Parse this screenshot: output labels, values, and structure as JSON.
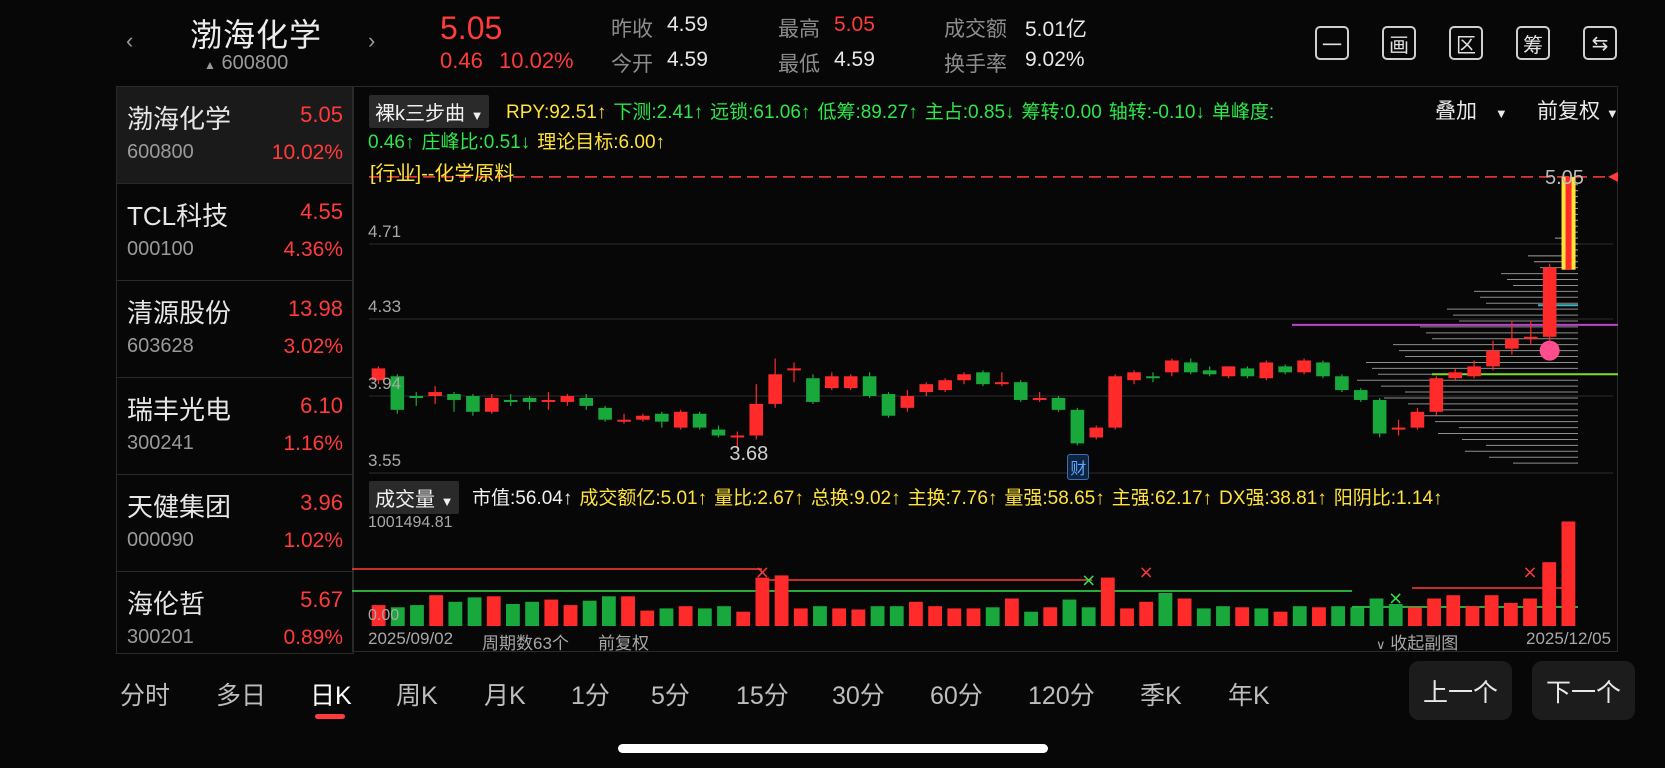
{
  "header": {
    "prev_icon": "chevron-left-icon",
    "next_icon": "chevron-right-icon",
    "stock_name": "渤海化学",
    "stock_code": "600800",
    "price": "5.05",
    "change": "0.46",
    "change_pct": "10.02%",
    "prev_close_label": "昨收",
    "prev_close": "4.59",
    "open_label": "今开",
    "open": "4.59",
    "high_label": "最高",
    "high": "5.05",
    "low_label": "最低",
    "low": "4.59",
    "amount_label": "成交额",
    "amount": "5.01亿",
    "turnover_label": "换手率",
    "turnover": "9.02%",
    "icons": [
      {
        "glyph": "一",
        "name": "minus-icon"
      },
      {
        "glyph": "画",
        "name": "draw-icon"
      },
      {
        "glyph": "区",
        "name": "range-icon"
      },
      {
        "glyph": "筹",
        "name": "chips-icon"
      },
      {
        "glyph": "⇆",
        "name": "switch-screen-icon"
      }
    ]
  },
  "watchlist": [
    {
      "name": "渤海化学",
      "code": "600800",
      "price": "5.05",
      "pct": "10.02%"
    },
    {
      "name": "TCL科技",
      "code": "000100",
      "price": "4.55",
      "pct": "4.36%"
    },
    {
      "name": "清源股份",
      "code": "603628",
      "price": "13.98",
      "pct": "3.02%"
    },
    {
      "name": "瑞丰光电",
      "code": "300241",
      "price": "6.10",
      "pct": "1.16%"
    },
    {
      "name": "天健集团",
      "code": "000090",
      "price": "3.96",
      "pct": "1.02%"
    },
    {
      "name": "海伦哲",
      "code": "300201",
      "price": "5.67",
      "pct": "0.89%"
    }
  ],
  "main_chart": {
    "selector": "裸k三步曲",
    "indicators_line1": [
      {
        "t": "RPY:92.51↑",
        "c": "y"
      },
      {
        "t": "下测:2.41↑",
        "c": "g"
      },
      {
        "t": "远锁:61.06↑",
        "c": "g"
      },
      {
        "t": "低筹:89.27↑",
        "c": "g"
      },
      {
        "t": "主占:0.85↓",
        "c": "g"
      },
      {
        "t": "筹转:0.00",
        "c": "g"
      },
      {
        "t": "轴转:-0.10↓",
        "c": "g"
      },
      {
        "t": "单峰度:",
        "c": "g"
      }
    ],
    "indicators_line2": [
      {
        "t": "0.46↑",
        "c": "g"
      },
      {
        "t": "庄峰比:0.51↓",
        "c": "g"
      },
      {
        "t": "理论目标:6.00↑",
        "c": "y"
      }
    ],
    "overlay": "叠加",
    "adjust": "前复权",
    "industry": "[行业]--化学原料",
    "y_labels": [
      "4.71",
      "4.33",
      "3.94",
      "3.55"
    ],
    "last_price_label": "5.05",
    "low_annotation": "3.68",
    "cai_badge": "财"
  },
  "volume_chart": {
    "selector": "成交量",
    "indicators": [
      {
        "t": "市值:56.04↑",
        "c": "w"
      },
      {
        "t": "成交额亿:5.01↑",
        "c": "y"
      },
      {
        "t": "量比:2.67↑",
        "c": "y"
      },
      {
        "t": "总换:9.02↑",
        "c": "y"
      },
      {
        "t": "主换:7.76↑",
        "c": "y"
      },
      {
        "t": "量强:58.65↑",
        "c": "y"
      },
      {
        "t": "主强:62.17↑",
        "c": "y"
      },
      {
        "t": "DX强:38.81↑",
        "c": "y"
      },
      {
        "t": "阳阴比:1.14↑",
        "c": "y"
      }
    ],
    "max_label": "1001494.81",
    "zero_label": "0.00"
  },
  "footer_bar": {
    "start_date": "2025/09/02",
    "periods": "周期数63个",
    "adjust": "前复权",
    "collapse": "收起副图",
    "end_date": "2025/12/05"
  },
  "tabs": [
    "分时",
    "多日",
    "日K",
    "周K",
    "月K",
    "1分",
    "5分",
    "15分",
    "30分",
    "60分",
    "120分",
    "季K",
    "年K"
  ],
  "active_tab": "日K",
  "nav": {
    "prev": "上一个",
    "next": "下一个"
  },
  "colors": {
    "up": "#ff2a2a",
    "down": "#19a83c",
    "yellow": "#ffe23a",
    "green_text": "#2ee64a"
  },
  "chart_data": {
    "type": "candlestick",
    "y_ticks": [
      "4.71",
      "4.33",
      "3.94",
      "3.55"
    ],
    "ylim": [
      3.55,
      5.1
    ],
    "candles": [
      {
        "o": 4.02,
        "c": 4.08,
        "h": 4.09,
        "l": 4.0
      },
      {
        "o": 4.04,
        "c": 3.87,
        "h": 4.05,
        "l": 3.85
      },
      {
        "o": 3.94,
        "c": 3.93,
        "h": 3.96,
        "l": 3.89
      },
      {
        "o": 3.94,
        "c": 3.96,
        "h": 3.99,
        "l": 3.9
      },
      {
        "o": 3.95,
        "c": 3.92,
        "h": 3.96,
        "l": 3.86
      },
      {
        "o": 3.94,
        "c": 3.86,
        "h": 3.95,
        "l": 3.84
      },
      {
        "o": 3.86,
        "c": 3.93,
        "h": 3.95,
        "l": 3.85
      },
      {
        "o": 3.92,
        "c": 3.91,
        "h": 3.95,
        "l": 3.89
      },
      {
        "o": 3.93,
        "c": 3.91,
        "h": 3.94,
        "l": 3.87
      },
      {
        "o": 3.92,
        "c": 3.92,
        "h": 3.96,
        "l": 3.87
      },
      {
        "o": 3.91,
        "c": 3.94,
        "h": 3.95,
        "l": 3.89
      },
      {
        "o": 3.93,
        "c": 3.89,
        "h": 3.95,
        "l": 3.87
      },
      {
        "o": 3.88,
        "c": 3.82,
        "h": 3.89,
        "l": 3.81
      },
      {
        "o": 3.82,
        "c": 3.82,
        "h": 3.85,
        "l": 3.8
      },
      {
        "o": 3.82,
        "c": 3.84,
        "h": 3.85,
        "l": 3.81
      },
      {
        "o": 3.85,
        "c": 3.81,
        "h": 3.86,
        "l": 3.78
      },
      {
        "o": 3.78,
        "c": 3.86,
        "h": 3.87,
        "l": 3.77
      },
      {
        "o": 3.85,
        "c": 3.78,
        "h": 3.86,
        "l": 3.77
      },
      {
        "o": 3.77,
        "c": 3.74,
        "h": 3.79,
        "l": 3.73
      },
      {
        "o": 3.73,
        "c": 3.74,
        "h": 3.76,
        "l": 3.68
      },
      {
        "o": 3.74,
        "c": 3.9,
        "h": 4.0,
        "l": 3.72
      },
      {
        "o": 3.9,
        "c": 4.05,
        "h": 4.13,
        "l": 3.88
      },
      {
        "o": 4.08,
        "c": 4.08,
        "h": 4.11,
        "l": 4.01
      },
      {
        "o": 4.03,
        "c": 3.91,
        "h": 4.05,
        "l": 3.9
      },
      {
        "o": 3.98,
        "c": 4.04,
        "h": 4.06,
        "l": 3.97
      },
      {
        "o": 3.98,
        "c": 4.04,
        "h": 4.05,
        "l": 3.97
      },
      {
        "o": 4.04,
        "c": 3.94,
        "h": 4.06,
        "l": 3.93
      },
      {
        "o": 3.95,
        "c": 3.84,
        "h": 3.96,
        "l": 3.83
      },
      {
        "o": 3.88,
        "c": 3.94,
        "h": 3.97,
        "l": 3.86
      },
      {
        "o": 3.96,
        "c": 4.0,
        "h": 4.01,
        "l": 3.94
      },
      {
        "o": 3.97,
        "c": 4.02,
        "h": 4.03,
        "l": 3.96
      },
      {
        "o": 4.02,
        "c": 4.05,
        "h": 4.06,
        "l": 4.0
      },
      {
        "o": 4.06,
        "c": 4.0,
        "h": 4.07,
        "l": 3.99
      },
      {
        "o": 4.01,
        "c": 4.01,
        "h": 4.06,
        "l": 3.99
      },
      {
        "o": 4.01,
        "c": 3.92,
        "h": 4.02,
        "l": 3.91
      },
      {
        "o": 3.93,
        "c": 3.93,
        "h": 3.96,
        "l": 3.91
      },
      {
        "o": 3.93,
        "c": 3.87,
        "h": 3.94,
        "l": 3.86
      },
      {
        "o": 3.87,
        "c": 3.7,
        "h": 3.88,
        "l": 3.69
      },
      {
        "o": 3.73,
        "c": 3.78,
        "h": 3.79,
        "l": 3.72
      },
      {
        "o": 3.78,
        "c": 4.04,
        "h": 4.05,
        "l": 3.77
      },
      {
        "o": 4.02,
        "c": 4.06,
        "h": 4.07,
        "l": 4.0
      },
      {
        "o": 4.04,
        "c": 4.03,
        "h": 4.06,
        "l": 4.01
      },
      {
        "o": 4.06,
        "c": 4.12,
        "h": 4.13,
        "l": 4.04
      },
      {
        "o": 4.11,
        "c": 4.06,
        "h": 4.13,
        "l": 4.05
      },
      {
        "o": 4.07,
        "c": 4.05,
        "h": 4.09,
        "l": 4.04
      },
      {
        "o": 4.04,
        "c": 4.09,
        "h": 4.09,
        "l": 4.03
      },
      {
        "o": 4.08,
        "c": 4.04,
        "h": 4.09,
        "l": 4.03
      },
      {
        "o": 4.03,
        "c": 4.11,
        "h": 4.12,
        "l": 4.02
      },
      {
        "o": 4.09,
        "c": 4.06,
        "h": 4.1,
        "l": 4.05
      },
      {
        "o": 4.06,
        "c": 4.12,
        "h": 4.13,
        "l": 4.05
      },
      {
        "o": 4.11,
        "c": 4.04,
        "h": 4.12,
        "l": 4.03
      },
      {
        "o": 4.04,
        "c": 3.97,
        "h": 4.05,
        "l": 3.96
      },
      {
        "o": 3.97,
        "c": 3.92,
        "h": 3.98,
        "l": 3.91
      },
      {
        "o": 3.92,
        "c": 3.75,
        "h": 3.93,
        "l": 3.73
      },
      {
        "o": 3.78,
        "c": 3.78,
        "h": 3.82,
        "l": 3.74
      },
      {
        "o": 3.78,
        "c": 3.86,
        "h": 3.88,
        "l": 3.77
      },
      {
        "o": 3.86,
        "c": 4.03,
        "h": 4.04,
        "l": 3.84
      },
      {
        "o": 4.03,
        "c": 4.06,
        "h": 4.08,
        "l": 4.02
      },
      {
        "o": 4.04,
        "c": 4.09,
        "h": 4.12,
        "l": 4.03
      },
      {
        "o": 4.09,
        "c": 4.17,
        "h": 4.22,
        "l": 4.07
      },
      {
        "o": 4.18,
        "c": 4.23,
        "h": 4.32,
        "l": 4.15
      },
      {
        "o": 4.23,
        "c": 4.24,
        "h": 4.32,
        "l": 4.2
      },
      {
        "o": 4.24,
        "c": 4.59,
        "h": 4.61,
        "l": 4.22
      },
      {
        "o": 4.59,
        "c": 5.05,
        "h": 5.05,
        "l": 4.59
      }
    ],
    "volume_max": 1001494.81,
    "volumes": [
      0.19,
      0.17,
      0.19,
      0.28,
      0.22,
      0.26,
      0.27,
      0.2,
      0.22,
      0.24,
      0.19,
      0.23,
      0.27,
      0.27,
      0.14,
      0.16,
      0.18,
      0.16,
      0.18,
      0.13,
      0.44,
      0.46,
      0.16,
      0.18,
      0.16,
      0.15,
      0.18,
      0.18,
      0.22,
      0.18,
      0.16,
      0.16,
      0.17,
      0.25,
      0.13,
      0.17,
      0.24,
      0.17,
      0.44,
      0.16,
      0.22,
      0.3,
      0.25,
      0.16,
      0.18,
      0.17,
      0.16,
      0.13,
      0.18,
      0.17,
      0.18,
      0.17,
      0.25,
      0.2,
      0.17,
      0.25,
      0.28,
      0.18,
      0.28,
      0.21,
      0.25,
      0.58,
      0.95
    ]
  }
}
